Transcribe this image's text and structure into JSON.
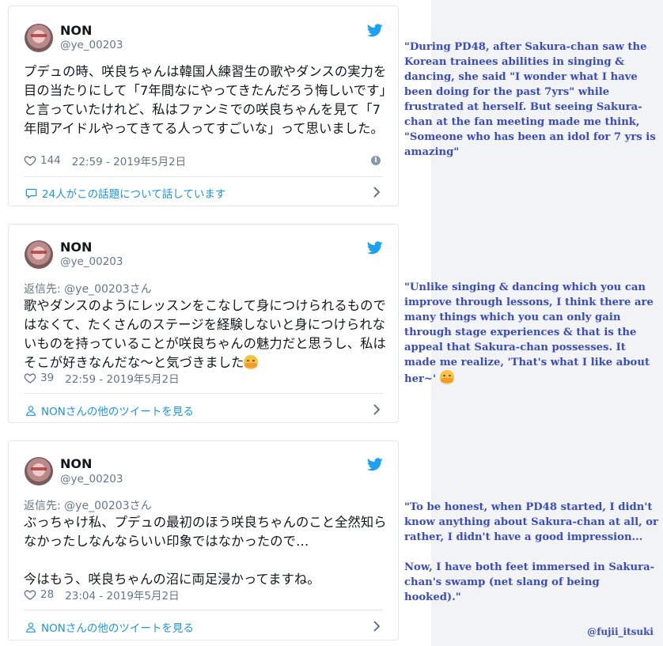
{
  "colors": {
    "link": "#1b95e0",
    "translation": "#3a4bc2",
    "bird": "#1da1f2",
    "muted": "#657786"
  },
  "tweets": [
    {
      "name": "NON",
      "handle": "@ye_00203",
      "reply_to": "",
      "text": "プデュの時、咲良ちゃんは韓国人練習生の歌やダンスの実力を目の当たりにして「7年間なにやってきたんだろう悔しいです」と言っていたけれど、私はファンミでの咲良ちゃんを見て「7年間アイドルやってきてる人ってすごいな」って思いました。",
      "likes": "144",
      "timestamp": "22:59 - 2019年5月2日",
      "footer": "24人がこの話題について話しています",
      "footer_icon": "speech-bubble-icon"
    },
    {
      "name": "NON",
      "handle": "@ye_00203",
      "reply_to": "返信先: @ye_00203さん",
      "text": "歌やダンスのようにレッスンをこなして身につけられるものではなくて、たくさんのステージを経験しないと身につけられないものを持っていることが咲良ちゃんの魅力だと思うし、私はそこが好きなんだな～と気づきました",
      "likes": "39",
      "timestamp": "22:59 - 2019年5月2日",
      "footer": "NONさんの他のツイートを見る",
      "footer_icon": "person-icon"
    },
    {
      "name": "NON",
      "handle": "@ye_00203",
      "reply_to": "返信先: @ye_00203さん",
      "text": "ぶっちゃけ私、プデュの最初のほう咲良ちゃんのこと全然知らなかったしなんならいい印象ではなかったので…\n\n今はもう、咲良ちゃんの沼に両足浸かってますね。",
      "likes": "28",
      "timestamp": "23:04 - 2019年5月2日",
      "footer": "NONさんの他のツイートを見る",
      "footer_icon": "person-icon"
    }
  ],
  "translations": [
    "\"During PD48, after Sakura-chan saw the Korean trainees abilities in singing & dancing, she said \"I wonder what I have been doing for the past 7yrs\" while frustrated at herself. But seeing Sakura-chan at the fan meeting made me think, \"Someone who has been an idol for 7 yrs is amazing\"",
    "\"Unlike singing & dancing which you can improve through lessons, I think there are many things which you can only gain through stage experiences & that is the appeal that Sakura-chan possesses. It made me realize, 'That's what I like about her~'",
    "\"To be honest, when PD48 started, I didn't know anything about Sakura-chan at all, or rather, I didn't have a good impression...\n\nNow, I have both feet immersed in Sakura-chan's swamp (net slang of being hooked).\""
  ],
  "credit": "@fujii_itsuki"
}
